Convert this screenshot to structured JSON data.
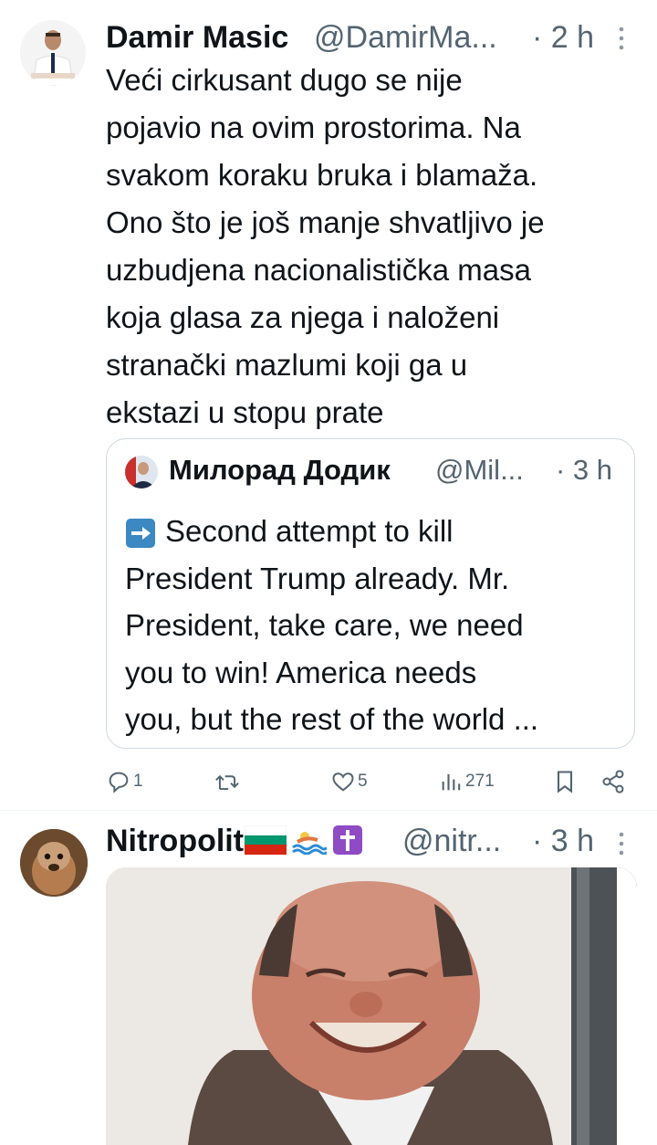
{
  "tweet1": {
    "name": "Damir Masic",
    "handle": "@DamirMa...",
    "time": "· 2 h",
    "more_icon": "more-icon",
    "text_lines": [
      "Veći cirkusant dugo se nije",
      "pojavio na ovim prostorima. Na",
      "svakom koraku bruka i blamaža.",
      "Ono što je još manje shvatljivo je",
      "uzbudjena nacionalistička masa",
      "koja glasa za njega i naloženi",
      "stranački mazlumi koji ga u",
      "ekstazi u stopu prate"
    ],
    "quote": {
      "name": "Милорад Додик",
      "handle": "@Mil...",
      "time": "· 3 h",
      "text_lines": [
        "Second attempt to kill",
        "President Trump already. Mr.",
        "President, take care, we need",
        "you to win!  America needs",
        "you, but the rest of the world ..."
      ]
    },
    "actions": {
      "reply_count": "1",
      "retweet_count": "",
      "like_count": "5",
      "views_count": "271"
    }
  },
  "tweet2": {
    "name": "Nitropolit",
    "handle": "@nitr...",
    "time": "· 3 h",
    "flag_colors": [
      "#ffffff",
      "#00966e",
      "#d62612"
    ]
  },
  "colors": {
    "text": "#0f1419",
    "secondary": "#536471",
    "border": "#cfd9de"
  }
}
